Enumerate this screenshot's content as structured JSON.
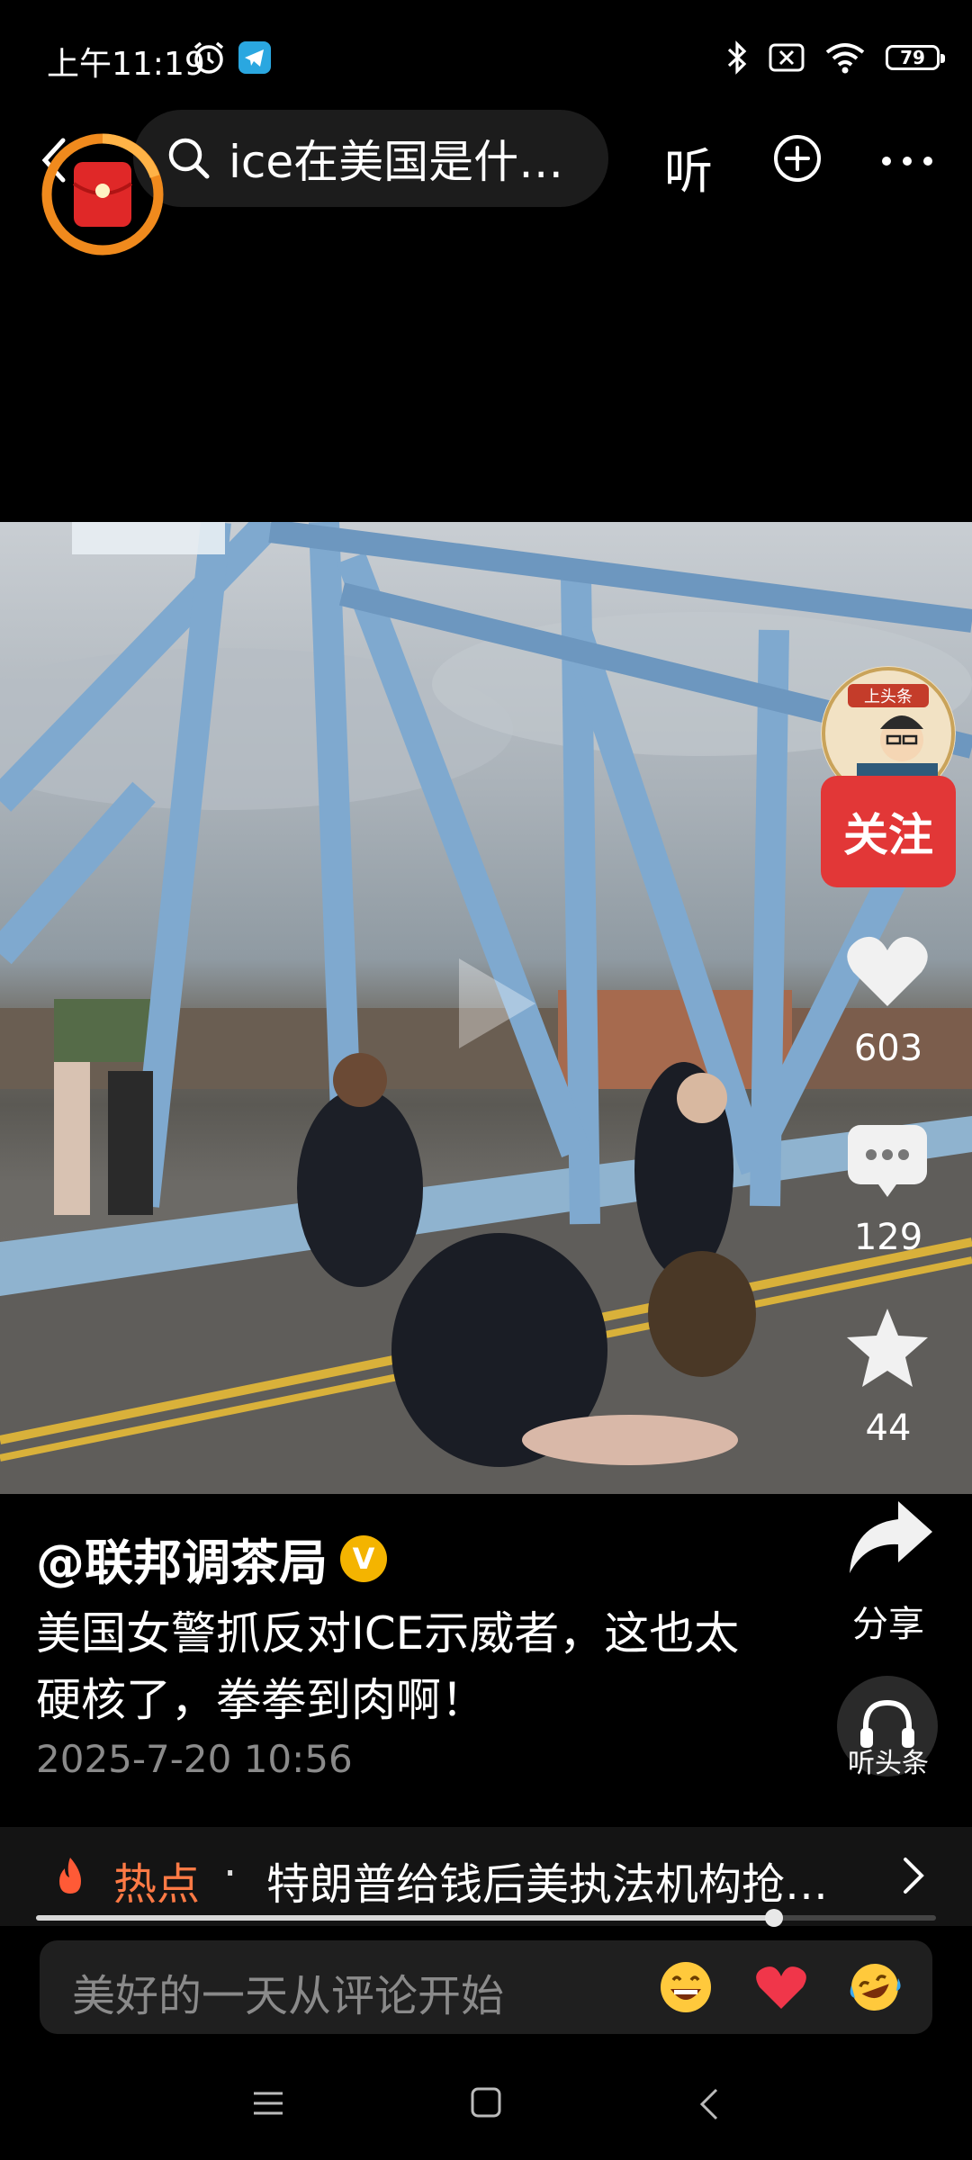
{
  "status_bar": {
    "time": "上午11:19",
    "battery": "79",
    "icons": [
      "alarm-icon",
      "telegram-icon",
      "bluetooth-icon",
      "no-sim-icon",
      "wifi-icon",
      "battery-icon"
    ]
  },
  "top_nav": {
    "search_text": "ice在美国是什…",
    "listen_label": "听",
    "icons": [
      "back-icon",
      "red-packet-icon",
      "search-icon",
      "add-icon",
      "more-icon"
    ]
  },
  "right_rail": {
    "follow_label": "关注",
    "likes": "603",
    "comments": "129",
    "favorites": "44",
    "share_label": "分享",
    "listen_label": "听头条",
    "avatar_text": "上头条"
  },
  "post": {
    "author": "@联邦调茶局",
    "verified_badge": "V",
    "caption": "美国女警抓反对ICE示威者，这也太硬核了，拳拳到肉啊！",
    "timestamp": "2025-7-20 10:56"
  },
  "hot": {
    "label": "热点",
    "separator": "·",
    "text": "特朗普给钱后美执法机构抢…"
  },
  "progress": {
    "fraction": 0.82
  },
  "comment_bar": {
    "placeholder": "美好的一天从评论开始",
    "emojis": [
      "grin-emoji",
      "heart-emoji",
      "laugh-cry-emoji"
    ]
  },
  "colors": {
    "follow": "#e23737",
    "hot": "#ff7a45",
    "verified": "#f4b400"
  }
}
